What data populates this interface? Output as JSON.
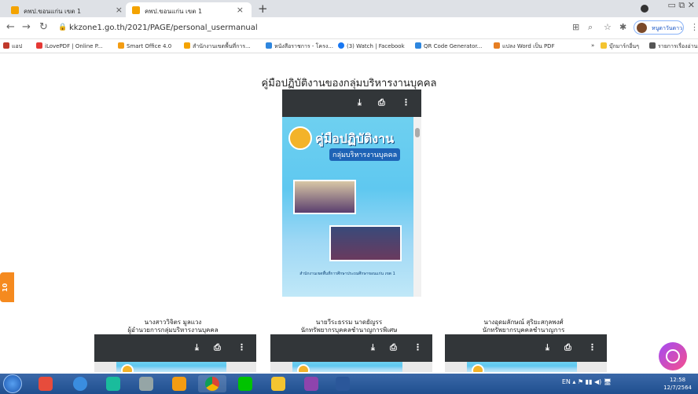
{
  "tabs": [
    {
      "label": "คพป.ขอนแก่น เขต 1",
      "active": false
    },
    {
      "label": "คพป.ขอนแก่น เขต 1",
      "active": true
    }
  ],
  "omnibox": {
    "url": "kkzone1.go.th/2021/PAGE/personal_usermanual",
    "profile_label": "หนูดาวันดาว"
  },
  "bookmarks": [
    {
      "label": "แอป",
      "icon": "apps-icon",
      "color": "#c0392b"
    },
    {
      "label": "iLovePDF | Online P...",
      "icon": "heart-icon",
      "color": "#e53935"
    },
    {
      "label": "Smart Office 4.0",
      "icon": "office-icon",
      "color": "#f39c12"
    },
    {
      "label": "สำนักงานเขตพื้นที่การ...",
      "icon": "obec-icon",
      "color": "#f4a300"
    },
    {
      "label": "หนังสือราชการ - โครง...",
      "icon": "doc-icon",
      "color": "#2e86de"
    },
    {
      "label": "(3) Watch | Facebook",
      "icon": "facebook-icon",
      "color": "#1877f2"
    },
    {
      "label": "QR Code Generator...",
      "icon": "qr-icon",
      "color": "#2e86de"
    },
    {
      "label": "แปลง Word เป็น PDF",
      "icon": "convert-icon",
      "color": "#e67e22"
    },
    {
      "label": "บุ๊กมาร์กอื่นๆ",
      "icon": "folder-icon",
      "color": "#f4c430"
    },
    {
      "label": "รายการเรื่องอ่าน",
      "icon": "reading-list-icon",
      "color": "#555555"
    }
  ],
  "page": {
    "title": "คู่มือปฏิบัติงานของกลุ่มบริหารงานบุคคล",
    "side_badge": "10"
  },
  "main_cover": {
    "title": "คู่มือปฏิบัติงาน",
    "subtitle": "กลุ่มบริหารงานบุคคล",
    "footer": "สำนักงานเขตพื้นที่การศึกษาประถมศึกษาขอนแก่น เขต 1"
  },
  "cards": [
    {
      "name": "นางสาววิจิตร มูลแวง",
      "role": "ผู้อำนวยการกลุ่มบริหารงานบุคคล"
    },
    {
      "name": "นายวีระธรรม นาดยัญรร",
      "role": "นักทรัพยากรบุคคลชำนาญการพิเศษ"
    },
    {
      "name": "นางอุดมลักษณ์ สุริยะสกุลพงศ์",
      "role": "นักทรัพยากรบุคคลชำนาญการ"
    }
  ],
  "taskbar": {
    "lang": "EN",
    "time": "12:58",
    "date": "12/7/2564"
  },
  "colors": {
    "viewer_toolbar": "#323639",
    "taskbar": "#1f4f8f",
    "badge": "#f58a1f"
  }
}
